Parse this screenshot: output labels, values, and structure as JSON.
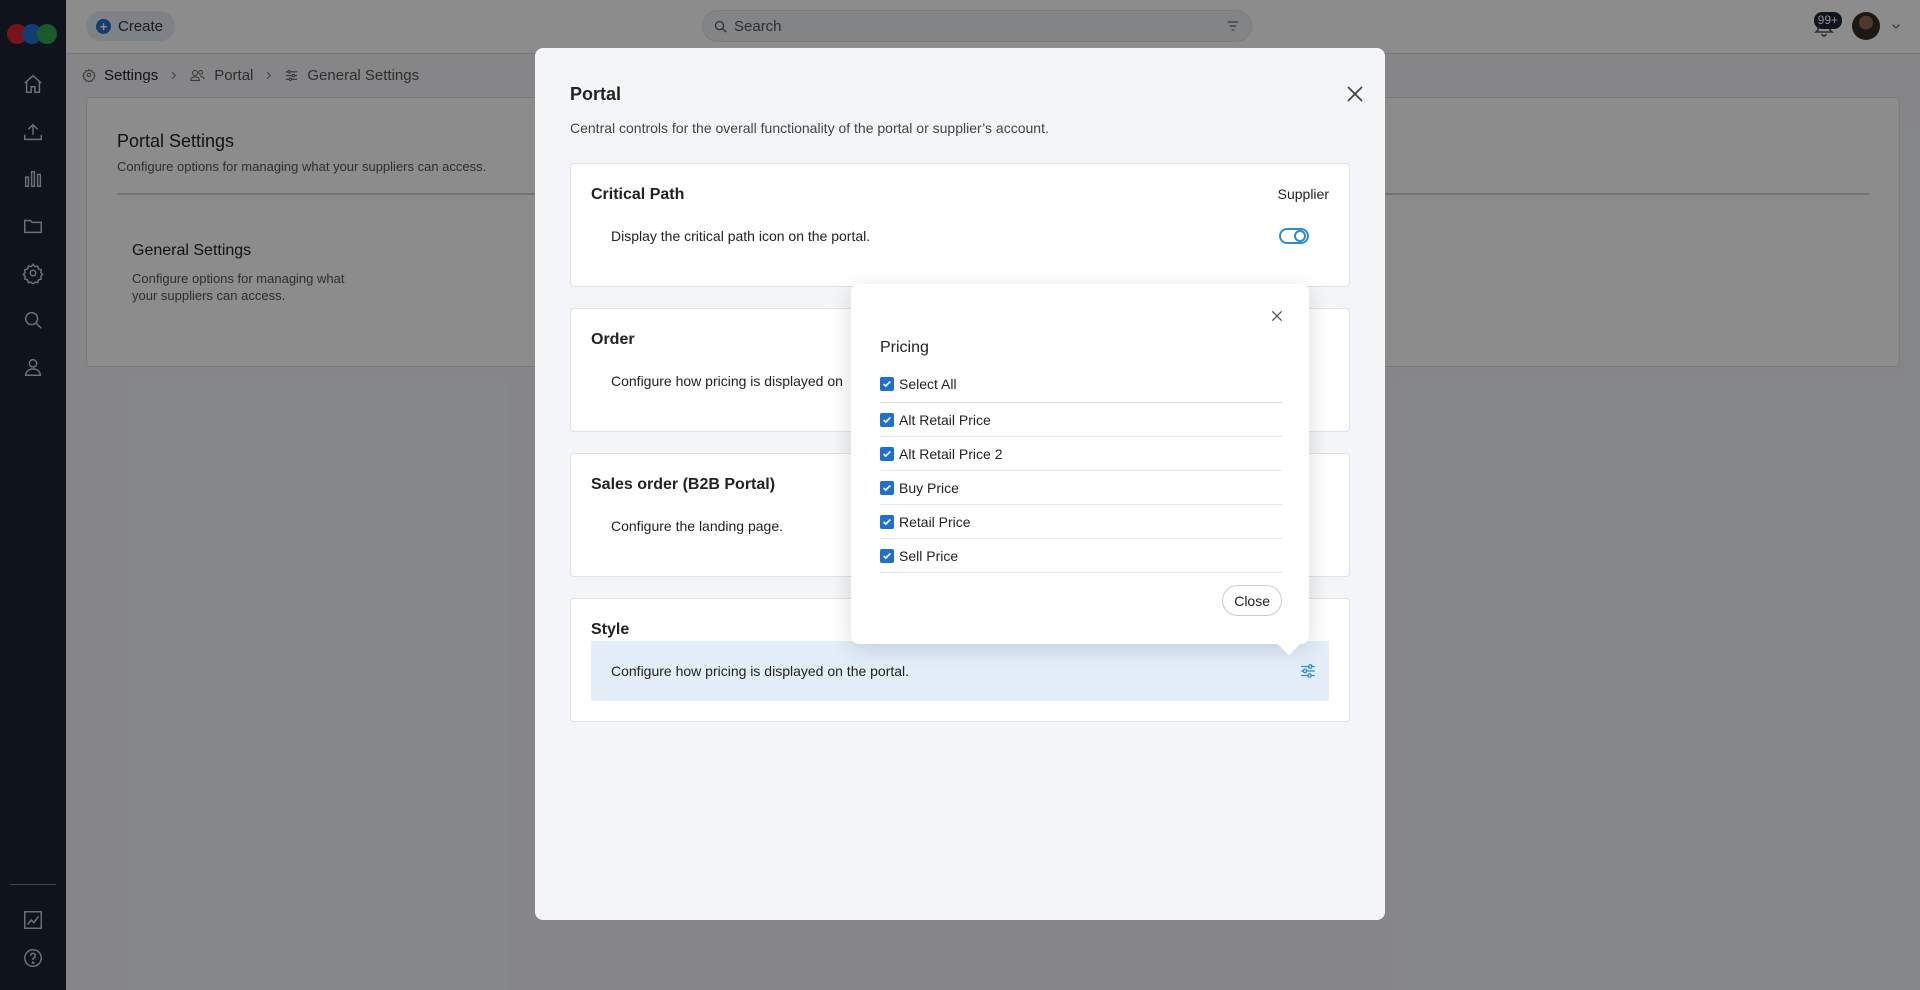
{
  "topbar": {
    "create_label": "Create",
    "search_placeholder": "Search",
    "notification_count": "99+"
  },
  "breadcrumb": [
    {
      "label": "Settings"
    },
    {
      "label": "Portal"
    },
    {
      "label": "General Settings"
    }
  ],
  "page": {
    "title": "Portal Settings",
    "subtitle": "Configure options for managing what your suppliers can access.",
    "general_settings": {
      "title": "General Settings",
      "description": "Configure options for managing what your suppliers can access."
    }
  },
  "modal": {
    "title": "Portal",
    "subtitle": "Central controls for the overall functionality of the portal or supplier’s account.",
    "sections": [
      {
        "title": "Critical Path",
        "right_label": "Supplier",
        "row_text": "Display the critical path icon on the portal.",
        "toggle_on": true
      },
      {
        "title": "Order",
        "row_text": "Configure how pricing is displayed on"
      },
      {
        "title": "Sales order (B2B Portal)",
        "row_text": "Configure the landing page."
      },
      {
        "title": "Style",
        "row_text": "Configure how pricing is displayed on the portal."
      }
    ]
  },
  "popover": {
    "title": "Pricing",
    "select_all_label": "Select All",
    "items": [
      {
        "label": "Alt Retail Price",
        "checked": true
      },
      {
        "label": "Alt Retail Price 2",
        "checked": true
      },
      {
        "label": "Buy Price",
        "checked": true
      },
      {
        "label": "Retail Price",
        "checked": true
      },
      {
        "label": "Sell Price",
        "checked": true
      }
    ],
    "close_label": "Close"
  },
  "colors": {
    "sidebar": "#1c2433",
    "accent": "#1f6fd1",
    "highlight_row": "#e4eefb"
  }
}
